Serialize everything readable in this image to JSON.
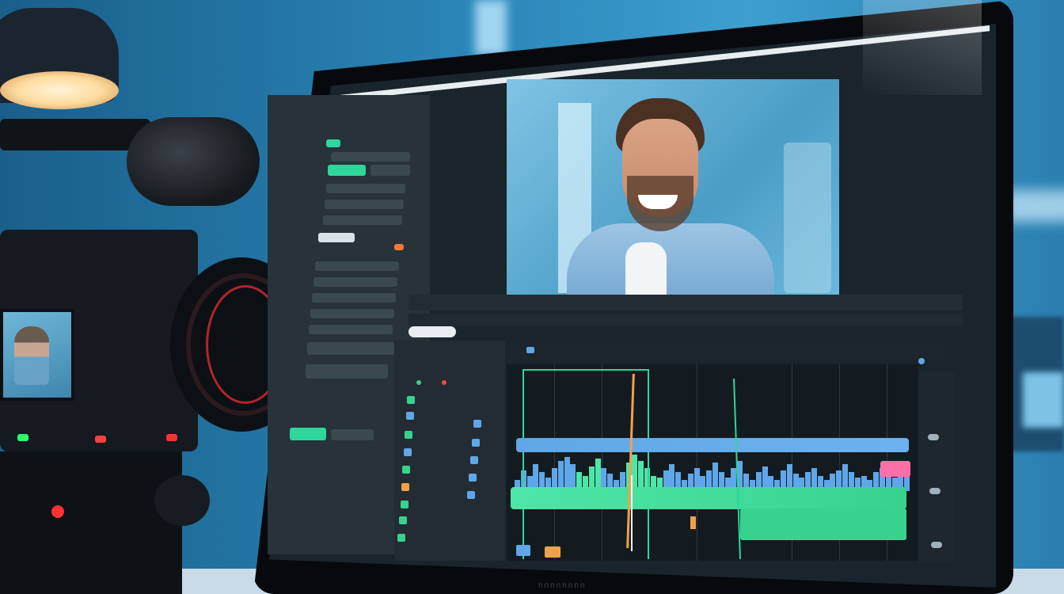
{
  "scene": {
    "description_free": true,
    "screen_brand": "nnnnnnnn"
  },
  "colors": {
    "studio_blue": "#2b86b8",
    "timeline_green": "#2fd69a",
    "clip_blue": "#5fa7e8",
    "clip_pink": "#ff6fa8",
    "accent_orange": "#f0a24a",
    "ui_dark": "#1a242b"
  },
  "icons": [
    "lamp-icon",
    "camera-icon",
    "microphone-icon",
    "monitor-icon"
  ],
  "waveform_levels": [
    0.3,
    0.55,
    0.4,
    0.7,
    0.5,
    0.35,
    0.6,
    0.8,
    0.9,
    0.7,
    0.5,
    0.4,
    0.65,
    0.85,
    0.6,
    0.45,
    0.3,
    0.5,
    0.75,
    0.95,
    0.8,
    0.6,
    0.4,
    0.35,
    0.55,
    0.7,
    0.5,
    0.3,
    0.45,
    0.6,
    0.4,
    0.55,
    0.75,
    0.5,
    0.35,
    0.6,
    0.8,
    0.45,
    0.3,
    0.5,
    0.65,
    0.4,
    0.3,
    0.55,
    0.7,
    0.45,
    0.35,
    0.5,
    0.6,
    0.4,
    0.3,
    0.45,
    0.55,
    0.7,
    0.5,
    0.35,
    0.4,
    0.3,
    0.5,
    0.6,
    0.45,
    0.35,
    0.5,
    0.65
  ]
}
